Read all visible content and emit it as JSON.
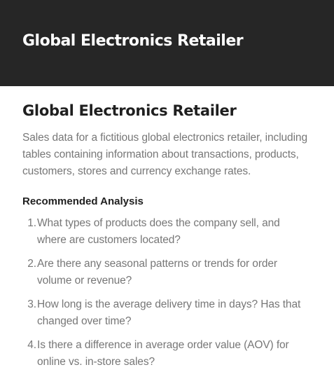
{
  "header": {
    "title": "Global Electronics Retailer"
  },
  "main": {
    "title": "Global Electronics Retailer",
    "description": "Sales data for a fictitious global electronics retailer, including tables containing information about transactions, products, customers, stores and currency exchange rates.",
    "analysis_heading": "Recommended Analysis",
    "analysis_items": [
      {
        "num": "1.",
        "text": "What types of products does the company sell, and where are customers located?"
      },
      {
        "num": "2.",
        "text": "Are there any seasonal patterns or trends for order volume or revenue?"
      },
      {
        "num": "3.",
        "text": "How long is the average delivery time in days? Has that changed over time?"
      },
      {
        "num": "4.",
        "text": "Is there a difference in average order value (AOV) for online vs. in-store sales?"
      }
    ]
  },
  "colors": {
    "header_bg": "#262626",
    "header_text": "#ffffff",
    "heading_text": "#1f1f1f",
    "body_text": "#777777"
  }
}
